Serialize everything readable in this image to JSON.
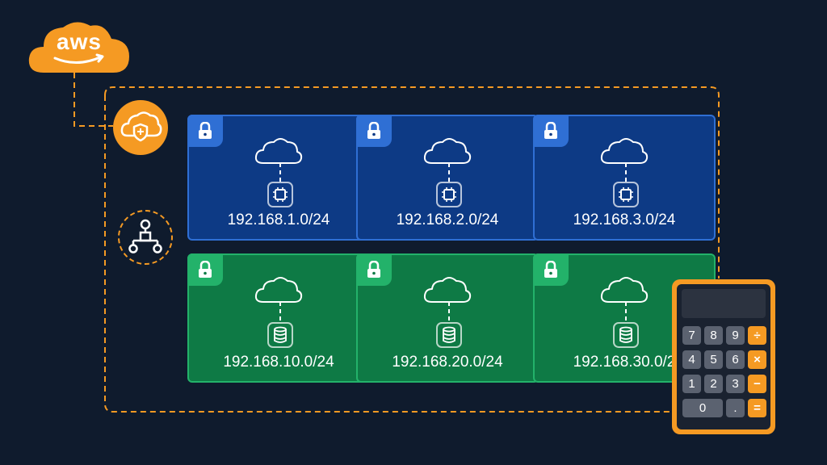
{
  "brand": {
    "logo_text": "aws"
  },
  "colors": {
    "background": "#0f1b2d",
    "accent_orange": "#f59a23",
    "public_subnet_fill": "#0d3a85",
    "public_subnet_border": "#2f6fd4",
    "private_subnet_fill": "#0e7a45",
    "private_subnet_border": "#23b26a"
  },
  "icons": {
    "gateway": "cloud-shield-icon",
    "router": "network-router-icon",
    "subnet_tab": "lock-icon",
    "public_node": "chip-icon",
    "private_node": "database-icon",
    "calculator": "calculator-icon"
  },
  "subnets": {
    "public": [
      {
        "cidr": "192.168.1.0/24"
      },
      {
        "cidr": "192.168.2.0/24"
      },
      {
        "cidr": "192.168.3.0/24"
      }
    ],
    "private": [
      {
        "cidr": "192.168.10.0/24"
      },
      {
        "cidr": "192.168.20.0/24"
      },
      {
        "cidr": "192.168.30.0/2"
      }
    ]
  },
  "calculator": {
    "keys": [
      "7",
      "8",
      "9",
      "÷",
      "4",
      "5",
      "6",
      "×",
      "1",
      "2",
      "3",
      "−",
      "0",
      ".",
      "="
    ]
  }
}
